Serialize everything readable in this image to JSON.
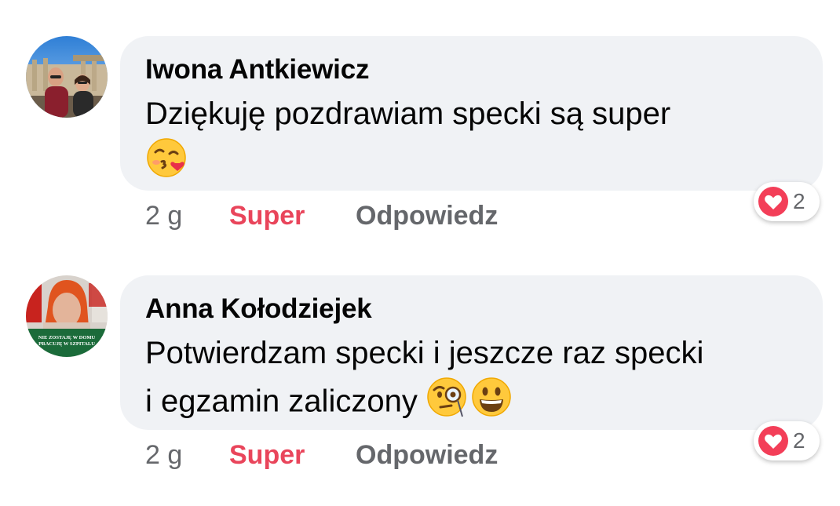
{
  "comments": [
    {
      "author": "Iwona Antkiewicz",
      "text": "Dziękuję pozdrawiam specki  są super",
      "emoji": "kissing-face-with-heart",
      "time": "2 g",
      "like_label": "Super",
      "reply_label": "Odpowiedz",
      "reaction_count": "2",
      "reaction_type": "heart-icon"
    },
    {
      "author": "Anna Kołodziejek",
      "text_line1": "Potwierdzam specki i jeszcze raz specki",
      "text_line2": "i egzamin zaliczony",
      "emoji": [
        "face-with-monocle",
        "grinning-face"
      ],
      "avatar_banner": "NIE ZOSTAJĘ W DOMU PRACUJĘ W SZPITALU",
      "avatar_banner_line1": "NIE ZOSTAJĘ W DOMU",
      "avatar_banner_line2": "PRACUJĘ W SZPITALU",
      "time": "2 g",
      "like_label": "Super",
      "reply_label": "Odpowiedz",
      "reaction_count": "2",
      "reaction_type": "heart-icon"
    }
  ],
  "colors": {
    "bubble": "#f0f2f5",
    "super_red": "#e9455b",
    "meta_gray": "#65676b",
    "text": "#050505"
  }
}
